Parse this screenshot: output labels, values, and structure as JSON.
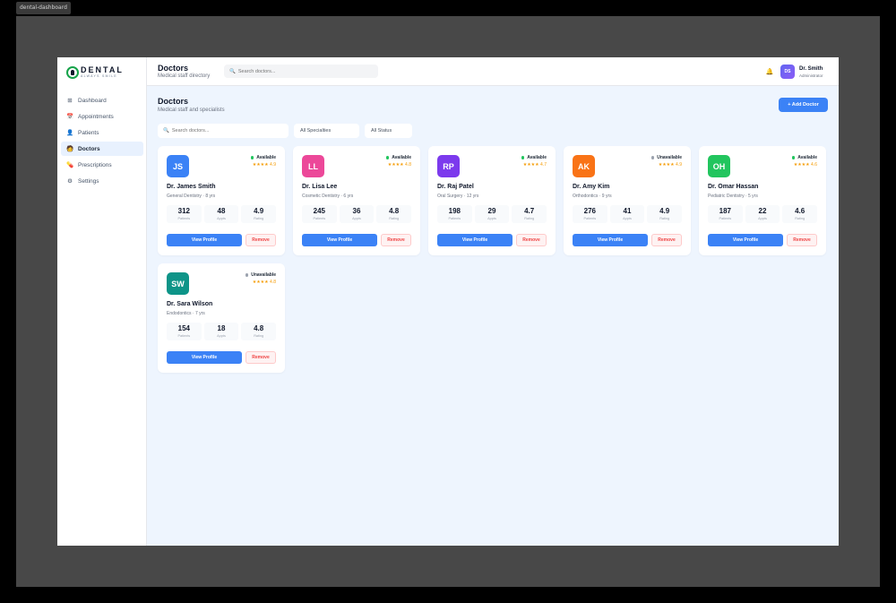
{
  "window_tag": "dental-dashboard",
  "brand": {
    "name": "DENTAL",
    "tagline": "ALWAYS SMILE"
  },
  "sidebar": {
    "items": [
      {
        "label": "Dashboard",
        "icon": "grid-icon",
        "glyph": "⊞"
      },
      {
        "label": "Appointments",
        "icon": "calendar-icon",
        "glyph": "📅"
      },
      {
        "label": "Patients",
        "icon": "user-icon",
        "glyph": "👤"
      },
      {
        "label": "Doctors",
        "icon": "doctor-icon",
        "glyph": "🧑",
        "active": true
      },
      {
        "label": "Prescriptions",
        "icon": "pill-icon",
        "glyph": "💊"
      },
      {
        "label": "Settings",
        "icon": "gear-icon",
        "glyph": "⚙"
      }
    ]
  },
  "header": {
    "title": "Doctors",
    "subtitle": "Medical staff directory",
    "search_placeholder": "Search doctors...",
    "user": {
      "initials": "DS",
      "name": "Dr. Smith",
      "role": "Administrator"
    }
  },
  "main": {
    "title": "Doctors",
    "subtitle": "Medical staff and specialists",
    "add_label": "+ Add Doctor",
    "search_placeholder": "Search doctors...",
    "filter_specialty": "All Specialties",
    "filter_status": "All Status"
  },
  "doctors": [
    {
      "initials": "JS",
      "name": "Dr. James Smith",
      "spec": "General Dentistry · 8 yrs",
      "status": "Available",
      "stars": "★★★★ 4.9",
      "patients": "312",
      "appts": "48",
      "rating": "4.9",
      "color": "#3b82f6"
    },
    {
      "initials": "LL",
      "name": "Dr. Lisa Lee",
      "spec": "Cosmetic Dentistry · 6 yrs",
      "status": "Available",
      "stars": "★★★★ 4.8",
      "patients": "245",
      "appts": "36",
      "rating": "4.8",
      "color": "#ec4899"
    },
    {
      "initials": "RP",
      "name": "Dr. Raj Patel",
      "spec": "Oral Surgery · 12 yrs",
      "status": "Available",
      "stars": "★★★★ 4.7",
      "patients": "198",
      "appts": "29",
      "rating": "4.7",
      "color": "#7c3aed"
    },
    {
      "initials": "AK",
      "name": "Dr. Amy Kim",
      "spec": "Orthodontics · 9 yrs",
      "status": "Unavailable",
      "stars": "★★★★ 4.9",
      "patients": "276",
      "appts": "41",
      "rating": "4.9",
      "color": "#f97316"
    },
    {
      "initials": "OH",
      "name": "Dr. Omar Hassan",
      "spec": "Pediatric Dentistry · 5 yrs",
      "status": "Available",
      "stars": "★★★★ 4.6",
      "patients": "187",
      "appts": "22",
      "rating": "4.6",
      "color": "#22c55e"
    },
    {
      "initials": "SW",
      "name": "Dr. Sara Wilson",
      "spec": "Endodontics · 7 yrs",
      "status": "Unavailable",
      "stars": "★★★★ 4.8",
      "patients": "154",
      "appts": "18",
      "rating": "4.8",
      "color": "#0d9488"
    }
  ],
  "labels": {
    "patients": "Patients",
    "appts": "Appts",
    "rating": "Rating",
    "view": "View Profile",
    "remove": "Remove"
  },
  "colors": {
    "available": "#22c55e",
    "unavailable": "#9ca3af",
    "accent": "#3b82f6"
  }
}
